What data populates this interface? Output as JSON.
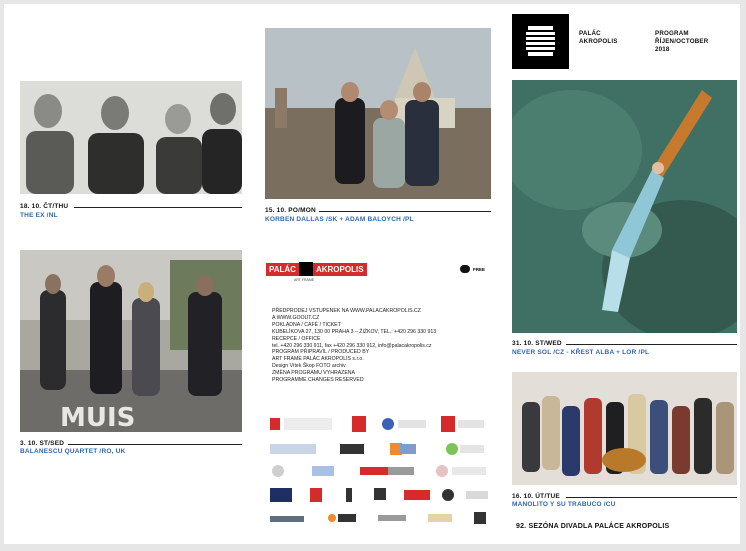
{
  "header": {
    "venue_line1": "PALÁC",
    "venue_line2": "AKROPOLIS",
    "program_line1": "PROGRAM",
    "program_line2": "ŘÍJEN/OCTOBER",
    "program_line3": "2018"
  },
  "events": [
    {
      "date": "18. 10. ČT/THU",
      "title": "THE EX /NL"
    },
    {
      "date": "3. 10. ST/SED",
      "title": "BALANESCU QUARTET /RO, UK"
    },
    {
      "date": "15. 10. PO/MON",
      "title": "KORBEN DALLAS /SK + ADAM BALOYCH /PL"
    },
    {
      "date": "31. 10. ST/WED",
      "title": "NEVER SOL /CZ - KŘEST ALBA + LOR /PL"
    },
    {
      "date": "16. 10. ÚT/TUE",
      "title": "MANOLITO Y SU TRABUCO /CU"
    }
  ],
  "logo": {
    "left": "PALÁC",
    "right": "AKROPOLIS",
    "sub": "ART FRAME",
    "badge": "FREE"
  },
  "photo_text": "MUIS",
  "info_lines": [
    "PŘEDPRODEJ VSTUPENEK NA WWW.PALACAKROPOLIS.CZ",
    "A WWW.GOOUT.CZ",
    "POKLADNA / CAFÉ / TICKET",
    "KUBELÍKOVA 27, 130 00 PRAHA 3 – ŽIŽKOV, TEL.: +420 296 330 913",
    "RECEPCE / OFFICE",
    "tel. +420 296 330 911, fax +420 296 330 912, info@palacakropolis.cz",
    "PROGRAM PŘIPRAVIL / PRODUCED BY",
    "ART FRAME PALÁC AKROPOLIS s.r.o.",
    "Design Vítek Škop FOTO archiv",
    "ZMĚNA PROGRAMU VYHRAZENA",
    "PROGRAMME CHANGES RESERVED"
  ],
  "footer": "92. SEZÓNA DIVADLA PALÁCE AKROPOLIS",
  "colors": {
    "accent_blue": "#2e66b3",
    "logo_red": "#d62b2b",
    "black": "#111111"
  }
}
